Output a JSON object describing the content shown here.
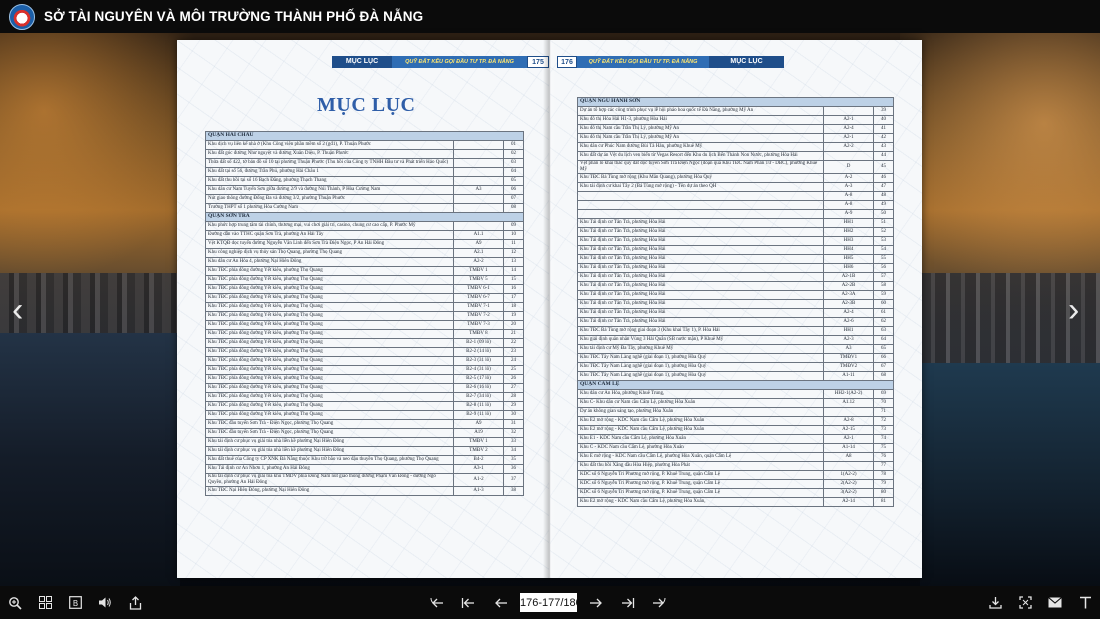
{
  "site": {
    "title": "SỞ TÀI NGUYÊN VÀ MÔI TRƯỜNG THÀNH PHỐ ĐÀ NẴNG"
  },
  "book": {
    "left_header": {
      "section": "MỤC LỤC",
      "subtitle": "QUỸ ĐẤT KÊU GỌI ĐẦU TƯ TP. ĐÀ NẴNG",
      "page": "175"
    },
    "right_header": {
      "page": "176",
      "subtitle": "QUỸ ĐẤT KÊU GỌI ĐẦU TƯ TP. ĐÀ NẴNG",
      "section": "MỤC LỤC"
    },
    "toc_title": "MỤC LỤC",
    "left_rows": [
      {
        "type": "sec",
        "name": "QUẬN HẢI CHÂU"
      },
      {
        "name": "Khu dịch vụ liên kế nhà ở (Khu Công viên phần mềm số 2 (gđ1), P. Thuận Phước",
        "code": "",
        "page": "01"
      },
      {
        "name": "Khu đất góc đường Như nguyệt và đường Xuân Diệu, P. Thuận Phước",
        "code": "",
        "page": "02"
      },
      {
        "name": "Thửa đất số 422, tờ bản đồ số 10 tại phường Thuận Phước (Thu hồi của Công ty TNHH Đầu tư và Phát triển Hảo Quốc)",
        "code": "",
        "page": "03"
      },
      {
        "name": "Khu đất tại số 56, đường Trần Phú, phường Hải Châu 1",
        "code": "",
        "page": "04"
      },
      {
        "name": "Khu đất thu hồi tại số 16 Bạch Đằng, phường Thạch Thang",
        "code": "",
        "page": "05"
      },
      {
        "name": "Khu dân cư Nam Tuyến Sơn giữa đường 2/9 và đường Núi Thành, P Hòa Cường Nam",
        "code": "A3",
        "page": "06"
      },
      {
        "name": "Nút giao thông đường Đống Đa và đường 3/2, phường Thuận Phước",
        "code": "",
        "page": "07"
      },
      {
        "name": "Trường THPT số 1 phường Hòa Cường Nam",
        "code": "",
        "page": "08"
      },
      {
        "type": "sec",
        "name": "QUẬN SƠN TRÀ"
      },
      {
        "name": "Khu phức hợp trung tâm tài chính, thương mại, vui chơi giải trí, casino, chung cư cao cấp, P. Phước Mỹ",
        "code": "",
        "page": "09"
      },
      {
        "name": "Đường dẫn vào TTHC quận Sơn Trà, phường An Hải Tây",
        "code": "A1.1",
        "page": "10"
      },
      {
        "name": "Vệt KTQĐ dọc tuyến đường Nguyễn Văn Linh đến Sơn Trà Điện Ngọc, P An Hải Đông",
        "code": "A9",
        "page": "11"
      },
      {
        "name": "Khu công nghiệp dịch vụ thủy sản Thọ Quang, phường Thọ Quang",
        "code": "A2.1",
        "page": "12"
      },
      {
        "name": "Khu dân cư An Hòa 4, phường Nại Hiên Đông",
        "code": "A2-2",
        "page": "13"
      },
      {
        "name": "Khu TĐC phía đông đường Yết kiêu, phường Thọ Quang",
        "code": "TMĐV 1",
        "page": "14"
      },
      {
        "name": "Khu TĐC phía đông đường Yết kiêu, phường Thọ Quang",
        "code": "TMĐV 5",
        "page": "15"
      },
      {
        "name": "Khu TĐC phía đông đường Yết kiêu, phường Thọ Quang",
        "code": "TMĐV 6-1",
        "page": "16"
      },
      {
        "name": "Khu TĐC phía đông đường Yết kiêu, phường Thọ Quang",
        "code": "TMĐV 6-7",
        "page": "17"
      },
      {
        "name": "Khu TĐC phía đông đường Yết kiêu, phường Thọ Quang",
        "code": "TMĐV 7-1",
        "page": "18"
      },
      {
        "name": "Khu TĐC phía đông đường Yết kiêu, phường Thọ Quang",
        "code": "TMĐV 7-2",
        "page": "19"
      },
      {
        "name": "Khu TĐC phía đông đường Yết kiêu, phường Thọ Quang",
        "code": "TMĐV 7-3",
        "page": "20"
      },
      {
        "name": "Khu TĐC phía đông đường Yết kiêu, phường Thọ Quang",
        "code": "TMĐV 8",
        "page": "21"
      },
      {
        "name": "Khu TĐC phía đông đường Yết kiêu, phường Thọ Quang",
        "code": "B2-1 (09 lô)",
        "page": "22"
      },
      {
        "name": "Khu TĐC phía đông đường Yết kiêu, phường Thọ Quang",
        "code": "B2-2 (14 lô)",
        "page": "23"
      },
      {
        "name": "Khu TĐC phía đông đường Yết kiêu, phường Thọ Quang",
        "code": "B2-3 (31 lô)",
        "page": "24"
      },
      {
        "name": "Khu TĐC phía đông đường Yết kiêu, phường Thọ Quang",
        "code": "B2-4 (31 lô)",
        "page": "25"
      },
      {
        "name": "Khu TĐC phía đông đường Yết kiêu, phường Thọ Quang",
        "code": "B2-5 (17 lô)",
        "page": "26"
      },
      {
        "name": "Khu TĐC phía đông đường Yết kiêu, phường Thọ Quang",
        "code": "B2-6 (16 lô)",
        "page": "27"
      },
      {
        "name": "Khu TĐC phía đông đường Yết kiêu, phường Thọ Quang",
        "code": "B2-7 (34 lô)",
        "page": "28"
      },
      {
        "name": "Khu TĐC phía đông đường Yết kiêu, phường Thọ Quang",
        "code": "B2-8 (11 lô)",
        "page": "29"
      },
      {
        "name": "Khu TĐC phía đông đường Yết kiêu, phường Thọ Quang",
        "code": "B2-9 (11 lô)",
        "page": "30"
      },
      {
        "name": "Khu TĐC đầu tuyến Sơn Trà - Điện Ngọc, phường Thọ Quang",
        "code": "A9",
        "page": "31"
      },
      {
        "name": "Khu TĐC đầu tuyến Sơn Trà - Điện Ngọc, phường Thọ Quang",
        "code": "A19",
        "page": "32"
      },
      {
        "name": "Khu tái định cư phục vụ giải tỏa nhà liền kề phường Nại Hiên Đông",
        "code": "TMĐV 1",
        "page": "33"
      },
      {
        "name": "Khu tái định cư phục vụ giải tỏa nhà liền kề phường Nại Hiên Đông",
        "code": "TMĐV 2",
        "page": "34"
      },
      {
        "name": "Khu đất thuê của Công ty CP XNK Đà Nẵng thuộc Khu trữ bão và neo đậu thuyền Thọ Quang, phường Thọ Quang",
        "code": "B4-2",
        "page": "35"
      },
      {
        "name": "Khu Tái định cư An Nhơn 1, phường An Hải Đông",
        "code": "A3-1",
        "page": "36"
      },
      {
        "name": "Khu tái định cư phục vụ giải tỏa khu TMDV phía Đông Nam nút giao thông đường Phạm Văn Đồng - đường Ngô Quyền, phường An Hải Đông",
        "code": "A1-2",
        "page": "37"
      },
      {
        "name": "Khu TĐC Nại Hiên Đông, phường Nại Hiên Đông",
        "code": "A1-3",
        "page": "38"
      }
    ],
    "right_rows": [
      {
        "type": "sec",
        "name": "QUẬN NGŨ HÀNH SƠN"
      },
      {
        "name": "Dự án tổ hợp các công trình phục vụ lễ hội pháo hoa quốc tế Đà Nẵng, phường Mỹ An",
        "code": "",
        "page": "39"
      },
      {
        "name": "Khu đô thị Hòa Hải H1-3, phường Hòa Hải",
        "code": "A2-1",
        "page": "40"
      },
      {
        "name": "Khu đô thị Nam cầu Trần Thị Lý, phường Mỹ An",
        "code": "A2-4",
        "page": "41"
      },
      {
        "name": "Khu đô thị Nam cầu Trần Thị Lý, phường Mỹ An",
        "code": "A2-1",
        "page": "42"
      },
      {
        "name": "Khu dân cư Phúc Nam đường Bùi Tá Hán, phường Khuê Mỹ",
        "code": "A2-2",
        "page": "43"
      },
      {
        "name": "Khu đất dự án Vệt du lịch ven biển từ Vegas Resort đến Khu du lịch Bến Thành Non Nước, phường Hòa Hải",
        "code": "",
        "page": "44"
      },
      {
        "name": "Vệt phân lô khai thác quỹ đất dọc tuyến Sơn Trà Điện Ngọc (đoạn qua Khu TĐC Nam Phan Tứ - DBC), phường Khuê Mỹ",
        "code": "D",
        "page": "45"
      },
      {
        "name": "Khu TĐC Bá Tùng mở rộng (Khu Mân Quang), phường Hòa Quý",
        "code": "A-2",
        "page": "46"
      },
      {
        "name": "Khu tái định cư khai Tây 2 (Bá Tùng mở rộng) - Tên dự án theo QH",
        "code": "A-3",
        "page": "47"
      },
      {
        "name": "",
        "code": "A-8",
        "page": "48"
      },
      {
        "name": "",
        "code": "A-8",
        "page": "49"
      },
      {
        "name": "",
        "code": "A-9",
        "page": "50"
      },
      {
        "name": "Khu Tái định cư Tân Trà, phường Hòa Hải",
        "code": "HH1",
        "page": "51"
      },
      {
        "name": "Khu Tái định cư Tân Trà, phường Hòa Hải",
        "code": "HH2",
        "page": "52"
      },
      {
        "name": "Khu Tái định cư Tân Trà, phường Hòa Hải",
        "code": "HH3",
        "page": "53"
      },
      {
        "name": "Khu Tái định cư Tân Trà, phường Hòa Hải",
        "code": "HH4",
        "page": "54"
      },
      {
        "name": "Khu Tái định cư Tân Trà, phường Hòa Hải",
        "code": "HH5",
        "page": "55"
      },
      {
        "name": "Khu Tái định cư Tân Trà, phường Hòa Hải",
        "code": "HH6",
        "page": "56"
      },
      {
        "name": "Khu Tái định cư Tân Trà, phường Hòa Hải",
        "code": "A2-1B",
        "page": "57"
      },
      {
        "name": "Khu Tái định cư Tân Trà, phường Hòa Hải",
        "code": "A2-2B",
        "page": "58"
      },
      {
        "name": "Khu Tái định cư Tân Trà, phường Hòa Hải",
        "code": "A2-3A",
        "page": "59"
      },
      {
        "name": "Khu Tái định cư Tân Trà, phường Hòa Hải",
        "code": "A2-3B",
        "page": "60"
      },
      {
        "name": "Khu Tái định cư Tân Trà, phường Hòa Hải",
        "code": "A2-4",
        "page": "61"
      },
      {
        "name": "Khu Tái định cư Tân Trà, phường Hòa Hải",
        "code": "A2-6",
        "page": "62"
      },
      {
        "name": "Khu TĐC Bá Tùng mở rộng giai đoạn 3 (Khu khai Tây 1), P. Hòa Hải",
        "code": "HH1",
        "page": "63"
      },
      {
        "name": "Khu giải định quân nhân Vùng 3 Hải Quân (SB nước mặn), P Khuê Mỹ",
        "code": "A2-3",
        "page": "64"
      },
      {
        "name": "Khu tái định cư Mỹ Đa Tây, phường Khuê Mỹ",
        "code": "A3",
        "page": "65"
      },
      {
        "name": "Khu TĐC Tây Nam Làng nghề (giai đoạn 1), phường Hòa Quý",
        "code": "TMĐV1",
        "page": "66"
      },
      {
        "name": "Khu TĐC Tây Nam Làng nghề (giai đoạn 1), phường Hòa Quý",
        "code": "TMĐV2",
        "page": "67"
      },
      {
        "name": "Khu TĐC Tây Nam Làng nghề (giai đoạn 1), phường Hòa Quý",
        "code": "A1-11",
        "page": "68"
      },
      {
        "type": "sec",
        "name": "QUẬN CẨM LỆ"
      },
      {
        "name": "Khu dân cư An Hòa, phường Khuê Trung,",
        "code": "HH2-1(A2-2)",
        "page": "69"
      },
      {
        "name": "Khu C- Khu dân cư Nam cầu Cẩm Lệ, phường Hòa Xuân",
        "code": "A1.12",
        "page": "70"
      },
      {
        "name": "Dự án không gian sáng tạo, phường Hòa Xuân",
        "code": "",
        "page": "71"
      },
      {
        "name": "Khu E2 mở rộng - KDC Nam cầu Cẩm Lệ, phường Hòa Xuân",
        "code": "A2-8",
        "page": "72"
      },
      {
        "name": "Khu E2 mở rộng - KDC Nam cầu Cẩm Lệ, phường Hòa Xuân",
        "code": "A2-15",
        "page": "73"
      },
      {
        "name": "Khu E1 - KDC Nam cầu Cẩm Lệ, phường Hòa Xuân",
        "code": "A2-1",
        "page": "74"
      },
      {
        "name": "Khu C - KDC Nam cầu Cẩm Lệ, phường Hòa Xuân",
        "code": "A1-14",
        "page": "75"
      },
      {
        "name": "Khu E mở rộng - KDC Nam cầu Cẩm Lệ, phường Hòa Xuân, quận Cẩm Lệ",
        "code": "A8",
        "page": "76"
      },
      {
        "name": "Khu đất thu hồi Xăng dầu Hòa Hiệp, phường Hòa Phát",
        "code": "",
        "page": "77"
      },
      {
        "name": "KDC số 6 Nguyễn Tri Phương mở rộng, P. Khuê Trung, quận Cẩm Lệ",
        "code": "1(A2-2)",
        "page": "78"
      },
      {
        "name": "KDC số 6 Nguyễn Tri Phương mở rộng, P. Khuê Trung, quận Cẩm Lệ",
        "code": "2(A2-2)",
        "page": "79"
      },
      {
        "name": "KDC số 6 Nguyễn Tri Phương mở rộng, P. Khuê Trung, quận Cẩm Lệ",
        "code": "3(A2-2)",
        "page": "80"
      },
      {
        "name": "Khu E2 mở rộng - KDC Nam cầu Cẩm Lệ, phường Hòa Xuân,",
        "code": "A2-14",
        "page": "81"
      }
    ]
  },
  "toolbar": {
    "page_value": "176-177/180",
    "icons_left": [
      "zoom-icon",
      "thumbnails-icon",
      "bookmark-icon",
      "sound-icon",
      "share-icon"
    ],
    "icons_center": [
      "first-page-icon",
      "previous-chapter-icon",
      "previous-page-icon",
      "next-page-icon",
      "next-chapter-icon",
      "last-page-icon"
    ],
    "icons_right": [
      "download-icon",
      "fullscreen-icon",
      "email-icon",
      "text-icon"
    ]
  }
}
